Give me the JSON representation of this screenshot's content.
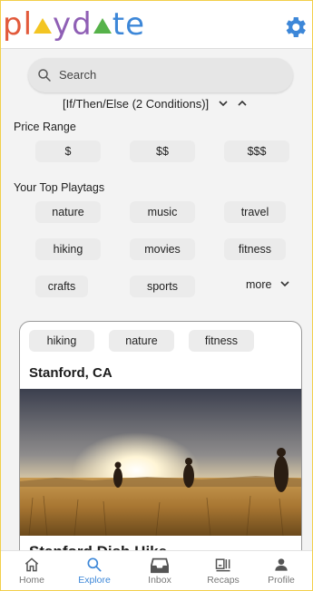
{
  "header": {
    "logo": [
      "p",
      "l",
      "y",
      "d",
      "t",
      "e"
    ],
    "settings_icon": "gear-icon",
    "brand_colors": {
      "p": "#e25a3b",
      "l": "#e25a3b",
      "y": "#8f5fb5",
      "d": "#8f5fb5",
      "t": "#3d87d8",
      "e": "#3d87d8",
      "tri1": "#f3c523",
      "tri2": "#56b24a",
      "gear": "#3d87d8"
    }
  },
  "search": {
    "placeholder": "Search",
    "icon": "search-icon"
  },
  "filters": {
    "condition_label": "[If/Then/Else (2 Conditions)]"
  },
  "price": {
    "title": "Price Range",
    "options": [
      "$",
      "$$",
      "$$$"
    ]
  },
  "playtags": {
    "title": "Your Top Playtags",
    "tags": [
      "nature",
      "music",
      "travel",
      "hiking",
      "movies",
      "fitness",
      "crafts",
      "sports"
    ],
    "more_label": "more"
  },
  "card": {
    "tags": [
      "hiking",
      "nature",
      "fitness"
    ],
    "location": "Stanford, CA",
    "title": "Stanford Dish Hike"
  },
  "nav": {
    "items": [
      {
        "label": "Home",
        "icon": "home-icon"
      },
      {
        "label": "Explore",
        "icon": "search-icon",
        "active": true
      },
      {
        "label": "Inbox",
        "icon": "inbox-icon"
      },
      {
        "label": "Recaps",
        "icon": "recaps-icon"
      },
      {
        "label": "Profile",
        "icon": "profile-icon"
      }
    ],
    "active_color": "#3d87d8"
  }
}
